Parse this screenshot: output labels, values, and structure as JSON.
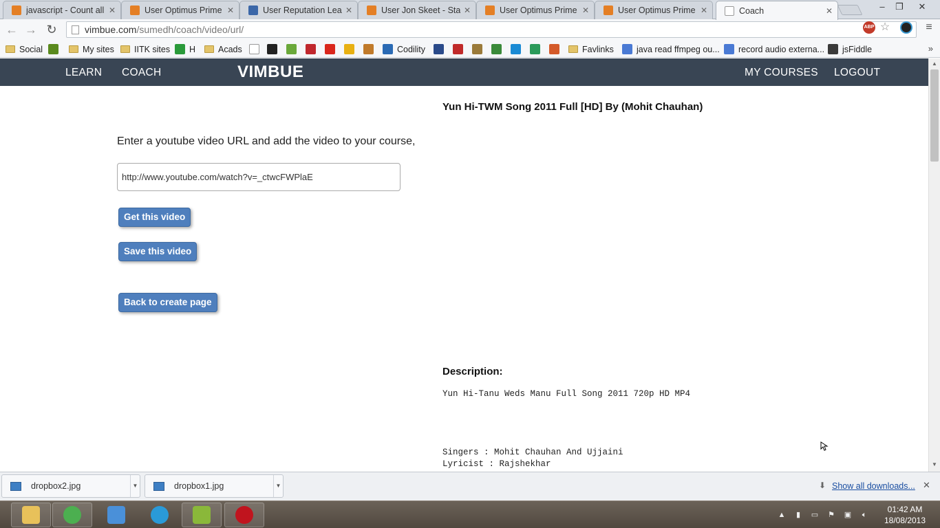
{
  "browser": {
    "tabs": [
      {
        "title": "javascript - Count all d",
        "favicon_color": "#e47f25"
      },
      {
        "title": "User Optimus Prime -",
        "favicon_color": "#e47f25"
      },
      {
        "title": "User Reputation Leagu",
        "favicon_color": "#3b67a8"
      },
      {
        "title": "User Jon Skeet - Stack",
        "favicon_color": "#e47f25"
      },
      {
        "title": "User Optimus Prime -",
        "favicon_color": "#e47f25"
      },
      {
        "title": "User Optimus Prime -",
        "favicon_color": "#e47f25"
      },
      {
        "title": "Coach",
        "favicon_color": "#ffffff",
        "active": true
      }
    ],
    "window_controls": {
      "minimize": "–",
      "restore": "❐",
      "close": "✕"
    },
    "url": {
      "domain": "vimbue.com",
      "path": "/sumedh/coach/video/url/"
    },
    "bookmarks": [
      {
        "label": "Social",
        "type": "folder"
      },
      {
        "label": "",
        "type": "icon",
        "color": "#5a8a1e"
      },
      {
        "label": "My sites",
        "type": "folder"
      },
      {
        "label": "IITK sites",
        "type": "folder"
      },
      {
        "label": "H",
        "type": "icon",
        "color": "#2a9a3a"
      },
      {
        "label": "Acads",
        "type": "folder"
      },
      {
        "label": "",
        "type": "icon",
        "color": "#ffffff"
      },
      {
        "label": "",
        "type": "icon",
        "color": "#222222"
      },
      {
        "label": "",
        "type": "icon",
        "color": "#6aa83a"
      },
      {
        "label": "",
        "type": "icon",
        "color": "#c0272d"
      },
      {
        "label": "",
        "type": "icon",
        "color": "#d9261c"
      },
      {
        "label": "",
        "type": "icon",
        "color": "#e8b012"
      },
      {
        "label": "",
        "type": "icon",
        "color": "#c07a2a"
      },
      {
        "label": "Codility",
        "type": "icon",
        "color": "#2a6ab4"
      },
      {
        "label": "",
        "type": "icon",
        "color": "#2a4a8a"
      },
      {
        "label": "",
        "type": "icon",
        "color": "#c02a2a"
      },
      {
        "label": "",
        "type": "icon",
        "color": "#9a7a3a"
      },
      {
        "label": "",
        "type": "icon",
        "color": "#3a8a3a"
      },
      {
        "label": "",
        "type": "icon",
        "color": "#1a8ad4"
      },
      {
        "label": "",
        "type": "icon",
        "color": "#2a9a5a"
      },
      {
        "label": "",
        "type": "icon",
        "color": "#d45a2a"
      },
      {
        "label": "Favlinks",
        "type": "folder"
      },
      {
        "label": "java read ffmpeg ou...",
        "type": "icon",
        "color": "#4a7ad4"
      },
      {
        "label": "record audio externa...",
        "type": "icon",
        "color": "#4a7ad4"
      },
      {
        "label": "jsFiddle",
        "type": "icon",
        "color": "#3a3a3a"
      }
    ],
    "bookmarks_more": "»"
  },
  "site": {
    "nav_left": [
      "LEARN",
      "COACH"
    ],
    "logo": "VIMBUE",
    "nav_right": [
      "MY COURSES",
      "LOGOUT"
    ]
  },
  "form": {
    "instruction": "Enter a youtube video URL and add the video to your course,",
    "url_value": "http://www.youtube.com/watch?v=_ctwcFWPlaE",
    "get_button": "Get this video",
    "save_button": "Save this video",
    "back_button": "Back to create page"
  },
  "video": {
    "title": "Yun Hi-TWM Song 2011 Full [HD] By (Mohit Chauhan)",
    "description_heading": "Description:",
    "description_lines": [
      "Yun Hi-Tanu Weds Manu Full Song 2011 720p HD MP4",
      "Singers : Mohit Chauhan And Ujjaini",
      "Lyricist : Rajshekhar"
    ]
  },
  "downloads": {
    "items": [
      {
        "name": "dropbox2.jpg"
      },
      {
        "name": "dropbox1.jpg"
      }
    ],
    "show_all": "Show all downloads...",
    "close": "✕"
  },
  "taskbar": {
    "apps": [
      {
        "name": "file-explorer",
        "color": "#e8c15a"
      },
      {
        "name": "chrome",
        "color": "#4caf50"
      },
      {
        "name": "app-3",
        "color": "#4a90d9"
      },
      {
        "name": "skype",
        "color": "#2a9ad8"
      },
      {
        "name": "notepad",
        "color": "#8ab83a"
      },
      {
        "name": "recorder",
        "color": "#c0141e"
      }
    ],
    "time": "01:42 AM",
    "date": "18/08/2013"
  },
  "colors": {
    "site_nav_bg": "#394554",
    "button_bg": "#4f7fbd"
  }
}
